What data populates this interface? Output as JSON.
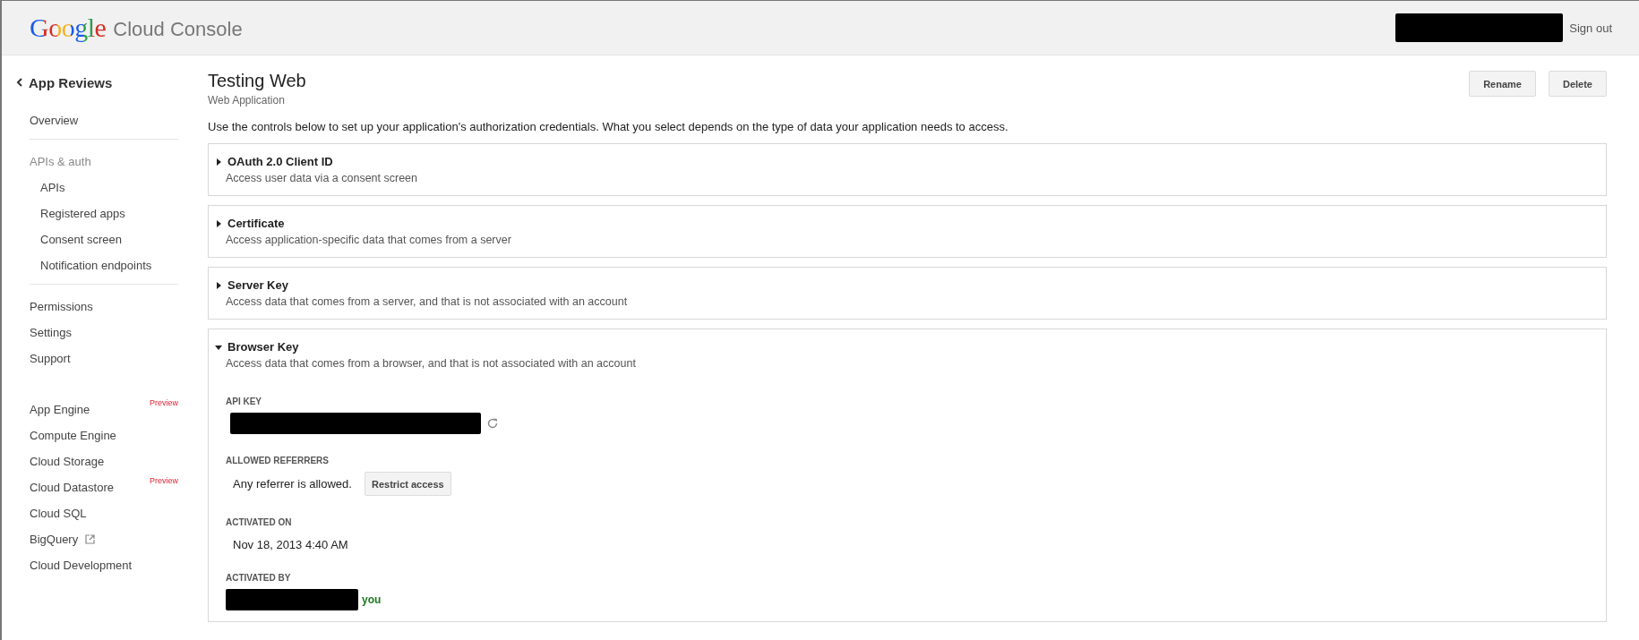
{
  "header": {
    "logo": "Google",
    "product": "Cloud Console",
    "sign_out": "Sign out"
  },
  "sidebar": {
    "back_title": "App Reviews",
    "groups": [
      [
        {
          "label": "Overview",
          "kind": "link"
        }
      ],
      [
        {
          "label": "APIs & auth",
          "kind": "heading"
        },
        {
          "label": "APIs",
          "kind": "subitem"
        },
        {
          "label": "Registered apps",
          "kind": "subitem"
        },
        {
          "label": "Consent screen",
          "kind": "subitem"
        },
        {
          "label": "Notification endpoints",
          "kind": "subitem"
        }
      ],
      [
        {
          "label": "Permissions",
          "kind": "link"
        },
        {
          "label": "Settings",
          "kind": "link"
        },
        {
          "label": "Support",
          "kind": "link"
        }
      ],
      [
        {
          "label": "App Engine",
          "kind": "link",
          "badge": "Preview"
        },
        {
          "label": "Compute Engine",
          "kind": "link"
        },
        {
          "label": "Cloud Storage",
          "kind": "link"
        },
        {
          "label": "Cloud Datastore",
          "kind": "link",
          "badge": "Preview"
        },
        {
          "label": "Cloud SQL",
          "kind": "link"
        },
        {
          "label": "BigQuery",
          "kind": "external"
        },
        {
          "label": "Cloud Development",
          "kind": "link"
        }
      ]
    ]
  },
  "page": {
    "title": "Testing Web",
    "subtitle": "Web Application",
    "buttons": [
      "Rename",
      "Delete"
    ],
    "intro": "Use the controls below to set up your application's authorization credentials. What you select depends on the type of data your application needs to access."
  },
  "cards": [
    {
      "title": "OAuth 2.0 Client ID",
      "description": "Access user data via a consent screen",
      "expanded": false
    },
    {
      "title": "Certificate",
      "description": "Access application-specific data that comes from a server",
      "expanded": false
    },
    {
      "title": "Server Key",
      "description": "Access data that comes from a server, and that is not associated with an account",
      "expanded": false
    },
    {
      "title": "Browser Key",
      "description": "Access data that comes from a browser, and that is not associated with an account",
      "expanded": true,
      "fields": [
        {
          "label": "API KEY",
          "kind": "key"
        },
        {
          "label": "ALLOWED REFERRERS",
          "kind": "referrers",
          "value": "Any referrer is allowed.",
          "button": "Restrict access"
        },
        {
          "label": "ACTIVATED ON",
          "kind": "text",
          "value": "Nov 18, 2013 4:40 AM"
        },
        {
          "label": "ACTIVATED BY",
          "kind": "user",
          "value": "you"
        }
      ]
    }
  ]
}
